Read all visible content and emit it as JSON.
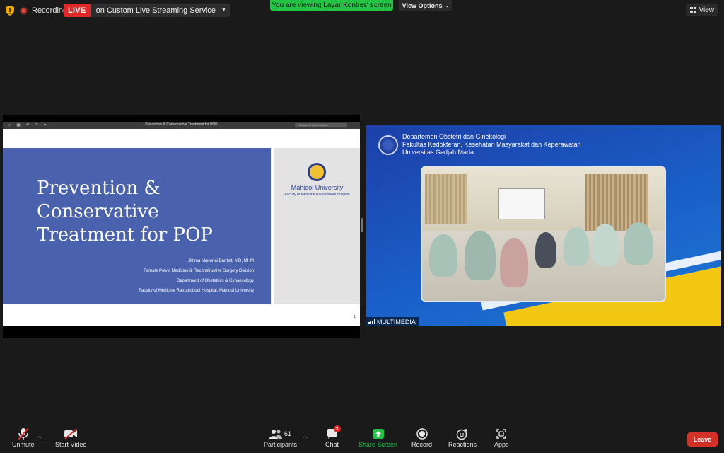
{
  "topbar": {
    "recording_label": "Recording",
    "live_badge": "LIVE",
    "live_service": "on Custom Live Streaming Service",
    "viewing_banner": "You are viewing Layar Konbes' screen",
    "view_options": "View Options",
    "view_label": "View"
  },
  "shared_slide": {
    "window_title": "Prevention & Conservative Treatment for POP",
    "search_placeholder": "Search in Presentation",
    "title_lines": [
      "Prevention &",
      "Conservative",
      "Treatment for POP"
    ],
    "credits": [
      "Jittima Manonai Bartlett, MD, MHM",
      "Female Pelvic Medicine & Reconstructive Surgery Division",
      "Department of Obstetrics & Gynaecology",
      "Faculty of Medicine Ramathibodi Hospital, Mahidol University"
    ],
    "university_name": "Mahidol University",
    "university_sub": "Faculty of Medicine Ramathibodi Hospital",
    "slide_number": "1"
  },
  "video": {
    "dept_lines": [
      "Departemen Obstetri dan Ginekologi",
      "Fakultas Kedokteran, Kesehatan Masyarakat dan Keperawatan",
      "Universitas Gadjah Mada"
    ],
    "participant_name": "MULTIMEDIA"
  },
  "toolbar": {
    "unmute": "Unmute",
    "start_video": "Start Video",
    "participants": "Participants",
    "participants_count": "61",
    "chat": "Chat",
    "chat_badge": "3",
    "share_screen": "Share Screen",
    "record": "Record",
    "reactions": "Reactions",
    "apps": "Apps",
    "leave": "Leave"
  },
  "colors": {
    "live_red": "#e02828",
    "share_green": "#23c343",
    "leave_red": "#d4302a",
    "slide_blue": "#4a62ad"
  }
}
